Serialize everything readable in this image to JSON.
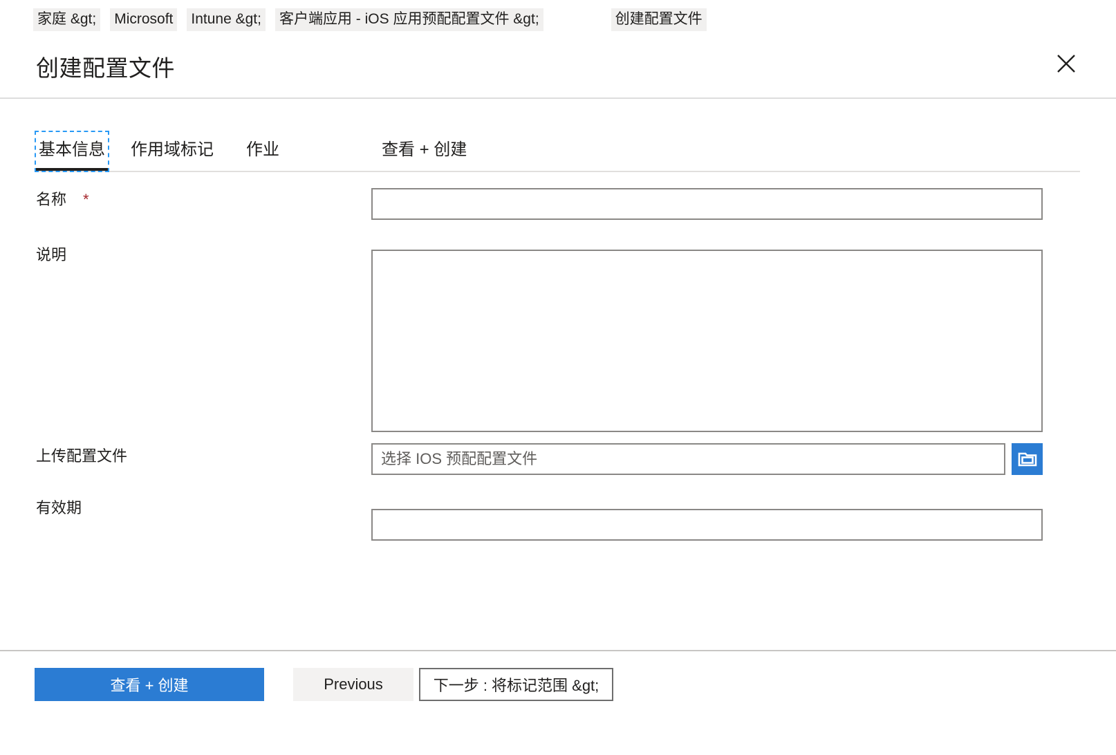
{
  "breadcrumb": {
    "items": [
      {
        "label": "家庭 &gt;"
      },
      {
        "label": "Microsoft"
      },
      {
        "label": "Intune &gt;"
      },
      {
        "label": "客户端应用 - iOS 应用预配配置文件 &gt;"
      },
      {
        "label": "创建配置文件"
      }
    ]
  },
  "header": {
    "title": "创建配置文件",
    "close_icon": "close-icon"
  },
  "tabs": [
    {
      "label": "基本信息",
      "active": true
    },
    {
      "label": "作用域标记",
      "active": false
    },
    {
      "label": "作业",
      "active": false
    },
    {
      "label": "查看 + 创建",
      "active": false
    }
  ],
  "form": {
    "name": {
      "label": "名称",
      "required_marker": "*",
      "value": "",
      "placeholder": ""
    },
    "description": {
      "label": "说明",
      "value": "",
      "placeholder": ""
    },
    "upload": {
      "label": "上传配置文件",
      "value": "",
      "placeholder": "选择 IOS 预配配置文件",
      "browse_icon": "folder-icon"
    },
    "validity": {
      "label": "有效期",
      "value": "",
      "placeholder": ""
    }
  },
  "footer": {
    "review_create": "查看 + 创建",
    "previous": "Previous",
    "next": "下一步 : 将标记范围 &gt;"
  },
  "colors": {
    "accent": "#2b7cd3",
    "required": "#a4262c",
    "border": "#8a8886",
    "tab_focus": "#2899f5",
    "secondary_bg": "#f3f2f1",
    "crumb_bg": "#f1f0ef"
  }
}
